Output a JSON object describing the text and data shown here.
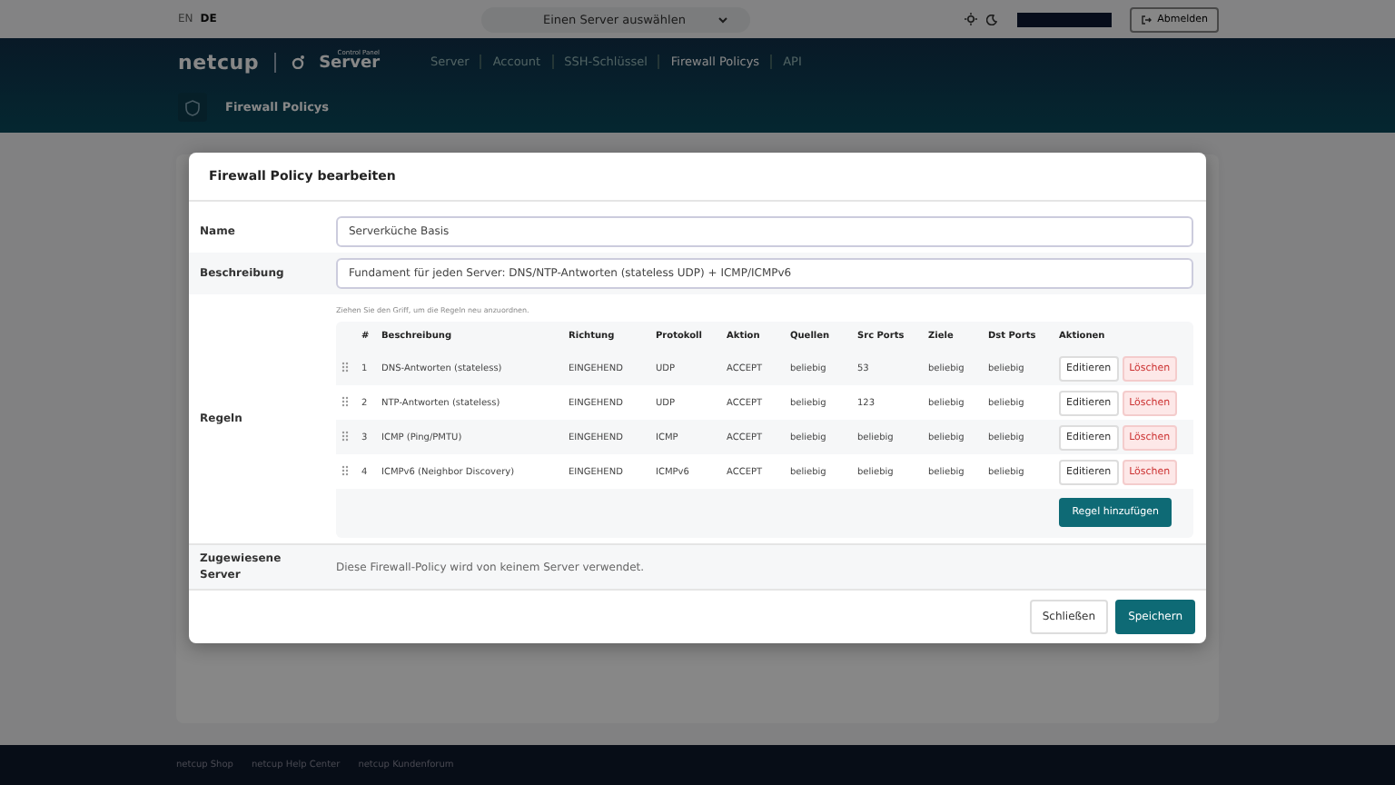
{
  "topbar": {
    "languages": [
      {
        "label": "EN",
        "selected": false
      },
      {
        "label": "DE",
        "selected": true
      }
    ],
    "server_select": {
      "value": "Einen Server auswählen"
    },
    "logout_button": "Abmelden"
  },
  "header": {
    "logo": {
      "brand": "netcup",
      "product_small": "Control Panel",
      "product": "Server"
    },
    "nav": [
      {
        "label": "Server",
        "selected": false
      },
      {
        "label": "Account",
        "selected": false
      },
      {
        "label": "SSH-Schlüssel",
        "selected": false
      },
      {
        "label": "Firewall Policys",
        "selected": true
      },
      {
        "label": "API",
        "selected": false
      }
    ],
    "page_title": "Firewall Policys"
  },
  "dialog": {
    "title": "Firewall Policy bearbeiten",
    "name": {
      "label": "Name",
      "value": "Serverküche Basis"
    },
    "description": {
      "label": "Beschreibung",
      "value": "Fundament für jeden Server: DNS/NTP-Antworten (stateless UDP) + ICMP/ICMPv6"
    },
    "rules": {
      "label": "Regeln",
      "hint": "Ziehen Sie den Griff, um die Regeln neu anzuordnen.",
      "columns": [
        "#",
        "Beschreibung",
        "Richtung",
        "Protokoll",
        "Aktion",
        "Quellen",
        "Src Ports",
        "Ziele",
        "Dst Ports",
        "Aktionen"
      ],
      "rows": [
        {
          "number": "1",
          "description": "DNS-Antworten (stateless)",
          "direction": "EINGEHEND",
          "protocol": "UDP",
          "action": "ACCEPT",
          "sources": "beliebig",
          "src_ports": "53",
          "targets": "beliebig",
          "dst_ports": "beliebig",
          "edit": "Editieren",
          "delete": "Löschen"
        },
        {
          "number": "2",
          "description": "NTP-Antworten (stateless)",
          "direction": "EINGEHEND",
          "protocol": "UDP",
          "action": "ACCEPT",
          "sources": "beliebig",
          "src_ports": "123",
          "targets": "beliebig",
          "dst_ports": "beliebig",
          "edit": "Editieren",
          "delete": "Löschen"
        },
        {
          "number": "3",
          "description": "ICMP (Ping/PMTU)",
          "direction": "EINGEHEND",
          "protocol": "ICMP",
          "action": "ACCEPT",
          "sources": "beliebig",
          "src_ports": "beliebig",
          "targets": "beliebig",
          "dst_ports": "beliebig",
          "edit": "Editieren",
          "delete": "Löschen"
        },
        {
          "number": "4",
          "description": "ICMPv6 (Neighbor Discovery)",
          "direction": "EINGEHEND",
          "protocol": "ICMPv6",
          "action": "ACCEPT",
          "sources": "beliebig",
          "src_ports": "beliebig",
          "targets": "beliebig",
          "dst_ports": "beliebig",
          "edit": "Editieren",
          "delete": "Löschen"
        }
      ],
      "add_button": "Regel hinzufügen"
    },
    "servers": {
      "label": "Zugewiesene Server",
      "text": "Diese Firewall-Policy wird von keinem Server verwendet."
    },
    "buttons": [
      {
        "label": "Schließen",
        "kind": "secondary"
      },
      {
        "label": "Speichern",
        "kind": "primary"
      }
    ]
  },
  "footer": {
    "links": [
      "netcup Shop",
      "netcup Help Center",
      "netcup Kundenforum"
    ]
  }
}
